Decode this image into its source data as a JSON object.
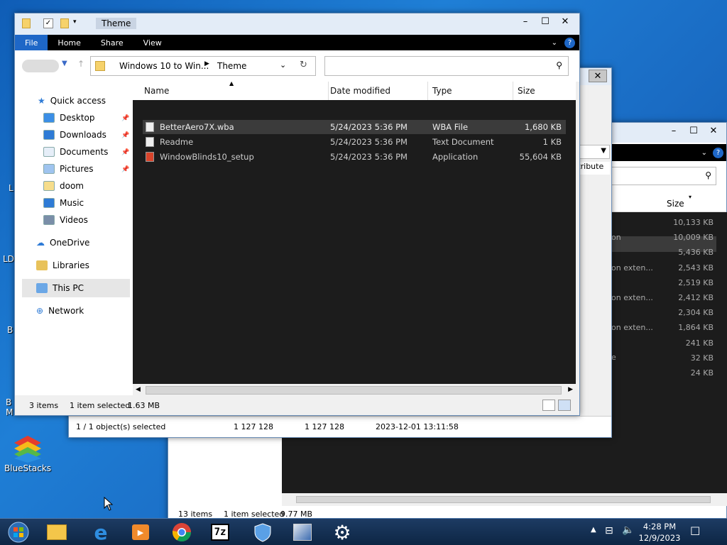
{
  "explorer": {
    "title": "Theme",
    "tabs": [
      "File",
      "Home",
      "Share",
      "View"
    ],
    "breadcrumb": [
      "Windows 10 to Win...",
      "Theme"
    ],
    "columns": [
      "Name",
      "Date modified",
      "Type",
      "Size"
    ],
    "nav": {
      "quick_access": "Quick access",
      "items": [
        "Desktop",
        "Downloads",
        "Documents",
        "Pictures",
        "doom",
        "Music",
        "Videos"
      ],
      "onedrive": "OneDrive",
      "libraries": "Libraries",
      "this_pc": "This PC",
      "network": "Network"
    },
    "files": [
      {
        "name": "BetterAero7X.wba",
        "date": "5/24/2023 5:36 PM",
        "type": "WBA File",
        "size": "1,680 KB"
      },
      {
        "name": "Readme",
        "date": "5/24/2023 5:36 PM",
        "type": "Text Document",
        "size": "1 KB"
      },
      {
        "name": "WindowBlinds10_setup",
        "date": "5/24/2023 5:36 PM",
        "type": "Application",
        "size": "55,604 KB"
      }
    ],
    "status": {
      "count": "3 items",
      "selected": "1 item selected",
      "size": "1.63 MB"
    }
  },
  "back_window": {
    "status": "1 / 1 object(s) selected",
    "size1": "1 127 128",
    "size2": "1 127 128",
    "date": "2023-12-01 13:11:58",
    "attribute": "ttribute"
  },
  "right_window": {
    "col": "Size",
    "sizes": [
      "10,133 KB",
      "10,009 KB",
      "5,436 KB",
      "2,543 KB",
      "2,519 KB",
      "2,412 KB",
      "2,304 KB",
      "1,864 KB",
      "241 KB",
      "32 KB",
      "24 KB"
    ],
    "partial": [
      "on",
      "on exten...",
      "on exten...",
      "on exten...",
      "e"
    ],
    "status_count": "13 items",
    "status_sel": "1 item selected",
    "status_size": "9.77 MB"
  },
  "desktop": {
    "bluestacks": "BlueStacks"
  },
  "taskbar": {
    "time": "4:28 PM",
    "date": "12/9/2023"
  }
}
